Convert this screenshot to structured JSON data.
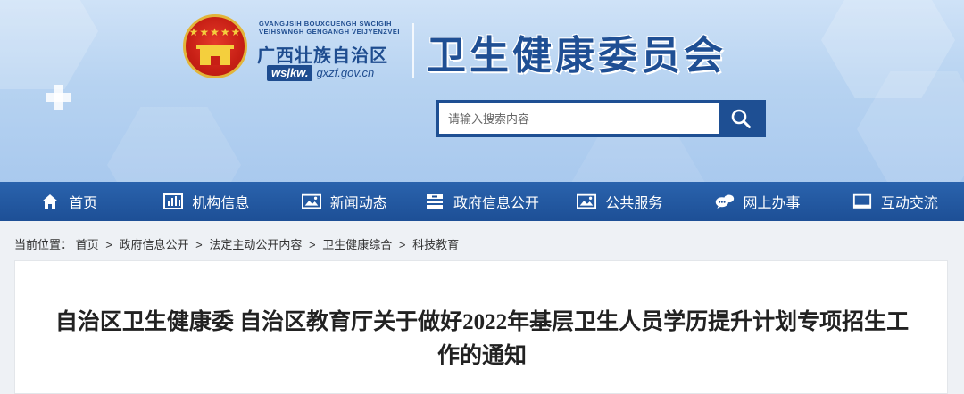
{
  "header": {
    "zhuang_line1": "GVANGJSIH BOUXCUENGH SWCIGIH",
    "zhuang_line2": "VEIHSWNGH GENGANGH VEIJYENZVEI",
    "region_name": "广西壮族自治区",
    "domain_prefix": "wsjkw.",
    "domain_rest": "gxzf.gov.cn",
    "site_title": "卫生健康委员会"
  },
  "search": {
    "placeholder": "请输入搜索内容",
    "value": ""
  },
  "nav": {
    "items": [
      {
        "label": "首页",
        "icon": "home-icon"
      },
      {
        "label": "机构信息",
        "icon": "bar-chart-icon"
      },
      {
        "label": "新闻动态",
        "icon": "image-icon"
      },
      {
        "label": "政府信息公开",
        "icon": "document-stack-icon"
      },
      {
        "label": "公共服务",
        "icon": "picture-icon"
      },
      {
        "label": "网上办事",
        "icon": "chat-bubbles-icon"
      },
      {
        "label": "互动交流",
        "icon": "monitor-icon"
      }
    ]
  },
  "breadcrumb": {
    "prefix": "当前位置：",
    "items": [
      "首页",
      "政府信息公开",
      "法定主动公开内容",
      "卫生健康综合",
      "科技教育"
    ],
    "separator": ">"
  },
  "article": {
    "title": "自治区卫生健康委 自治区教育厅关于做好2022年基层卫生人员学历提升计划专项招生工作的通知"
  },
  "colors": {
    "brand_blue": "#1e4f93",
    "header_bg": "#b7d3f1",
    "emblem_red": "#c71f15",
    "emblem_gold": "#f4cf3d"
  }
}
